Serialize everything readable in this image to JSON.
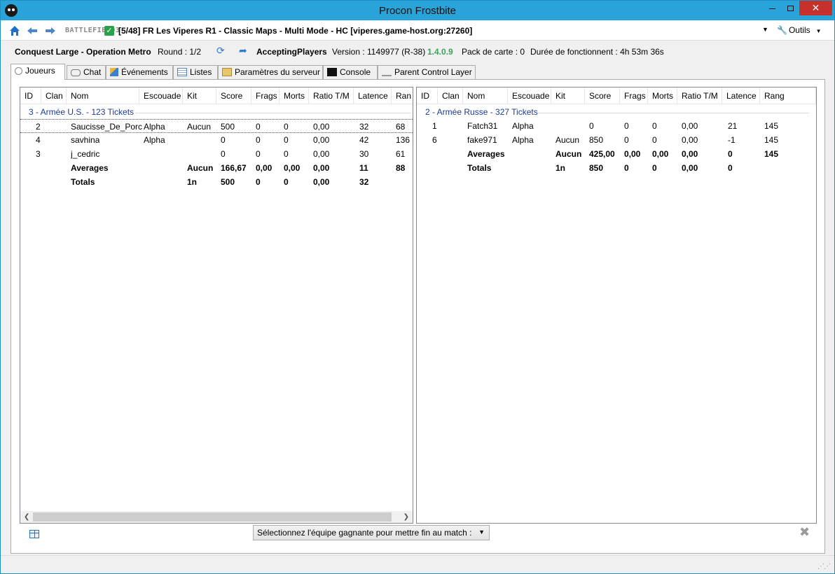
{
  "window": {
    "title": "Procon Frostbite",
    "close_glyph": "✕",
    "maximize_label": "",
    "minimize_label": ""
  },
  "connection": {
    "game_logo_text": "BATTLEFIELD3",
    "server_name": "[5/48] FR Les Viperes R1 - Classic Maps - Multi Mode - HC [viperes.game-host.org:27260]",
    "tools_label": "Outils"
  },
  "info": {
    "map_mode": "Conquest Large - Operation Metro",
    "round": "Round : 1/2",
    "state": "AcceptingPlayers",
    "version": "Version : 1149977 (R-38)",
    "procon_version": "1.4.0.9",
    "map_pack": "Pack de carte : 0",
    "uptime": "Durée de fonctionnent : 4h 53m 36s",
    "colors": {
      "procon_version": "#3aa35a",
      "accent": "#2aa3d8"
    }
  },
  "tabs": [
    {
      "label": "Joueurs",
      "icon": "players-icon"
    },
    {
      "label": "Chat",
      "icon": "chat-icon"
    },
    {
      "label": "Événements",
      "icon": "events-icon"
    },
    {
      "label": "Listes",
      "icon": "lists-icon"
    },
    {
      "label": "Paramètres du serveur",
      "icon": "settings-icon"
    },
    {
      "label": "Console",
      "icon": "console-icon"
    },
    {
      "label": "Parent Control Layer",
      "icon": "layer-icon"
    }
  ],
  "team1": {
    "columns": [
      "ID",
      "Clan",
      "Nom",
      "Escouade",
      "Kit",
      "Score",
      "Frags",
      "Morts",
      "Ratio T/M",
      "Latence",
      "Ran"
    ],
    "group": "3 - Armée U.S. - 123 Tickets",
    "players": [
      {
        "id": "2",
        "clan": "",
        "name": "Saucisse_De_Porc",
        "squad": "Alpha",
        "kit": "Aucun",
        "score": "500",
        "frags": "0",
        "deaths": "0",
        "ratio": "0,00",
        "latency": "32",
        "rank": "68"
      },
      {
        "id": "4",
        "clan": "",
        "name": "savhina",
        "squad": "Alpha",
        "kit": "",
        "score": "0",
        "frags": "0",
        "deaths": "0",
        "ratio": "0,00",
        "latency": "42",
        "rank": "136"
      },
      {
        "id": "3",
        "clan": "",
        "name": "j_cedric",
        "squad": "",
        "kit": "",
        "score": "0",
        "frags": "0",
        "deaths": "0",
        "ratio": "0,00",
        "latency": "30",
        "rank": "61"
      }
    ],
    "averages": {
      "label": "Averages",
      "kit": "Aucun",
      "score": "166,67",
      "frags": "0,00",
      "deaths": "0,00",
      "ratio": "0,00",
      "latency": "11",
      "rank": "88"
    },
    "totals": {
      "label": "Totals",
      "kit": "1n",
      "score": "500",
      "frags": "0",
      "deaths": "0",
      "ratio": "0,00",
      "latency": "32",
      "rank": ""
    }
  },
  "team2": {
    "columns": [
      "ID",
      "Clan",
      "Nom",
      "Escouade",
      "Kit",
      "Score",
      "Frags",
      "Morts",
      "Ratio T/M",
      "Latence",
      "Rang"
    ],
    "group": "2 - Armée Russe - 327 Tickets",
    "players": [
      {
        "id": "1",
        "clan": "",
        "name": "Fatch31",
        "squad": "Alpha",
        "kit": "",
        "score": "0",
        "frags": "0",
        "deaths": "0",
        "ratio": "0,00",
        "latency": "21",
        "rank": "145"
      },
      {
        "id": "6",
        "clan": "",
        "name": "fake971",
        "squad": "Alpha",
        "kit": "Aucun",
        "score": "850",
        "frags": "0",
        "deaths": "0",
        "ratio": "0,00",
        "latency": "-1",
        "rank": "145"
      }
    ],
    "averages": {
      "label": "Averages",
      "kit": "Aucun",
      "score": "425,00",
      "frags": "0,00",
      "deaths": "0,00",
      "ratio": "0,00",
      "latency": "0",
      "rank": "145"
    },
    "totals": {
      "label": "Totals",
      "kit": "1n",
      "score": "850",
      "frags": "0",
      "deaths": "0",
      "ratio": "0,00",
      "latency": "0",
      "rank": ""
    }
  },
  "bottom": {
    "winner_select": "Sélectionnez l'équipe gagnante pour mettre fin au match :"
  }
}
